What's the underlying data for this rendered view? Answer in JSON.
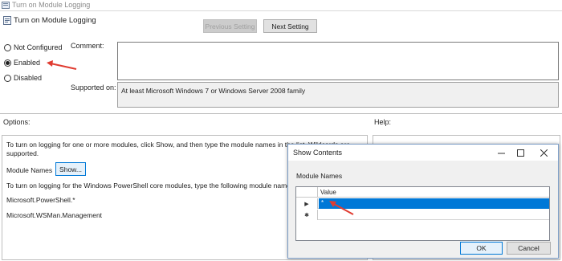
{
  "window": {
    "title": "Turn on Module Logging"
  },
  "header": {
    "title": "Turn on Module Logging"
  },
  "nav": {
    "previous_label": "Previous Setting",
    "next_label": "Next Setting"
  },
  "state": {
    "options": [
      {
        "label": "Not Configured",
        "selected": false
      },
      {
        "label": "Enabled",
        "selected": true
      },
      {
        "label": "Disabled",
        "selected": false
      }
    ]
  },
  "comment": {
    "label": "Comment:",
    "value": ""
  },
  "supported": {
    "label": "Supported on:",
    "value": "At least Microsoft Windows 7 or Windows Server 2008 family"
  },
  "options_section": {
    "label": "Options:",
    "line1": "To turn on logging for one or more modules, click Show, and then type the module names in the list. Wildcards are",
    "line1b": "supported.",
    "module_names_label": "Module Names",
    "show_button": "Show...",
    "line2": "To turn on logging for the Windows PowerShell core modules, type the following module names in the list:",
    "module1": "Microsoft.PowerShell.*",
    "module2": "Microsoft.WSMan.Management"
  },
  "help_section": {
    "label": "Help:"
  },
  "dialog": {
    "title": "Show Contents",
    "section_label": "Module Names",
    "column_header": "Value",
    "rows": [
      {
        "marker": "▶",
        "value": "*"
      },
      {
        "marker": "✱",
        "value": ""
      }
    ],
    "ok_label": "OK",
    "cancel_label": "Cancel"
  },
  "colors": {
    "accent": "#0078d7",
    "annotation_arrow": "#e03c31"
  },
  "icons": {
    "app": "policy-icon",
    "minimize": "minimize-icon",
    "maximize": "maximize-icon",
    "close": "close-icon"
  }
}
